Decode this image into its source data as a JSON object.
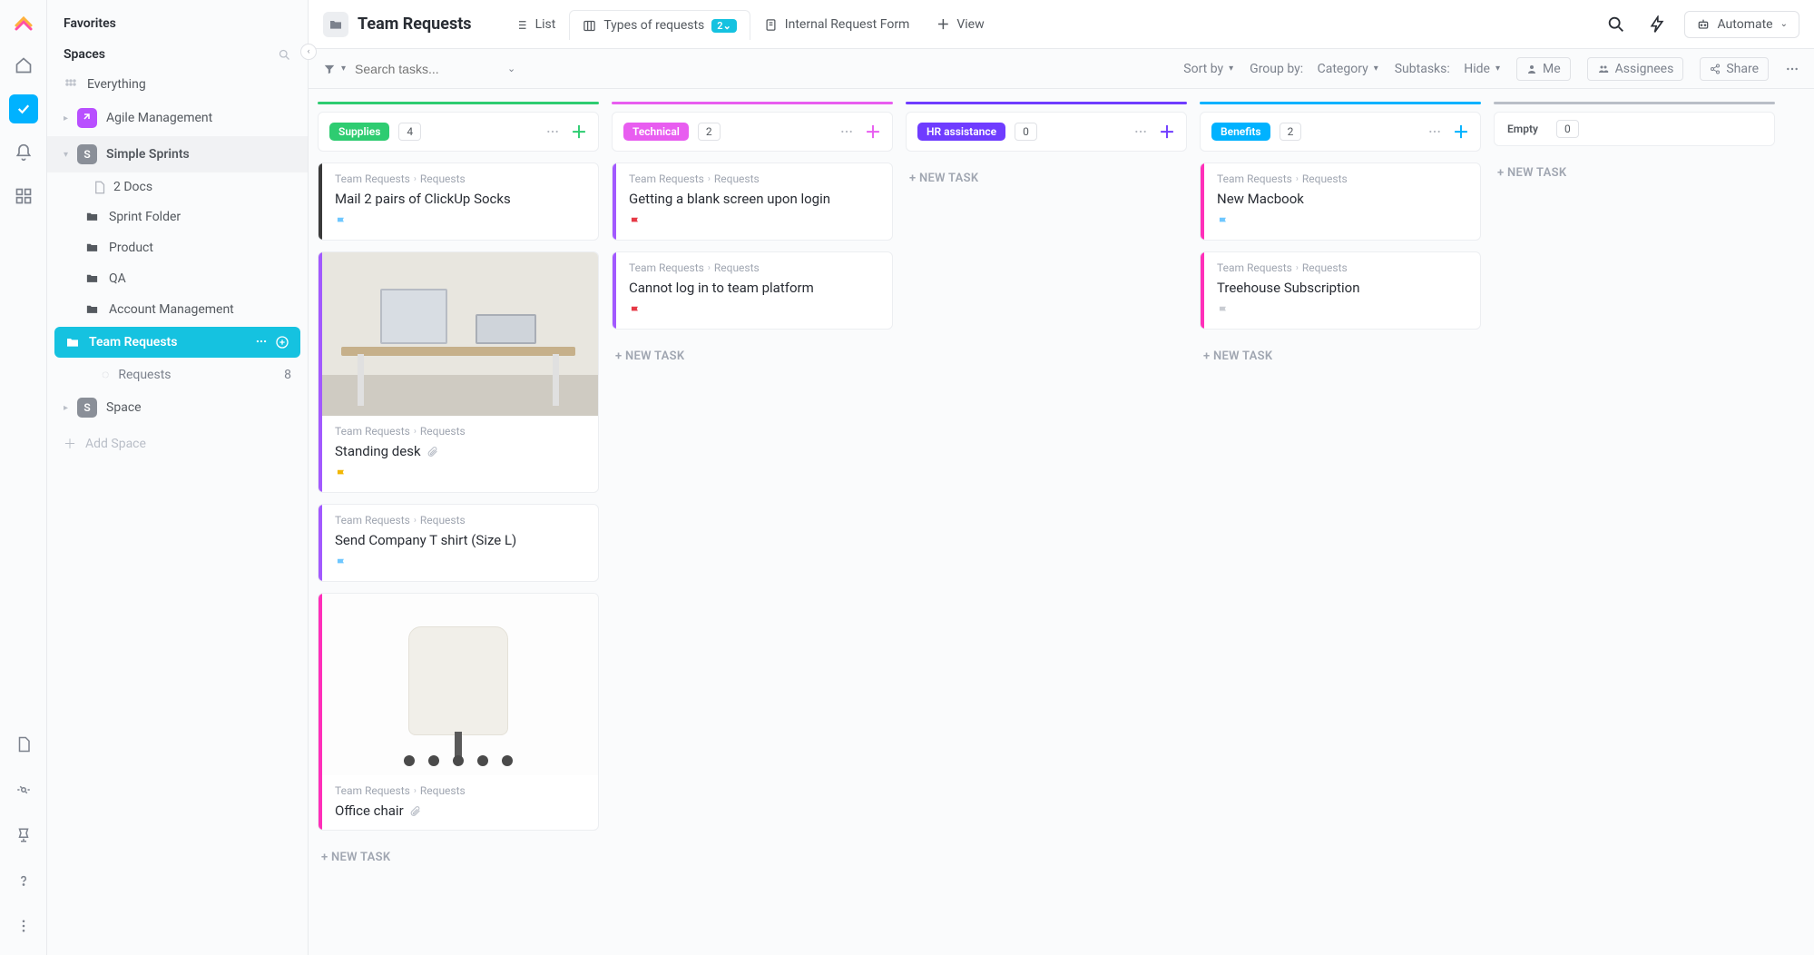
{
  "sidebar": {
    "favorites_label": "Favorites",
    "spaces_label": "Spaces",
    "everything_label": "Everything",
    "agile_label": "Agile Management",
    "simple_sprints_label": "Simple Sprints",
    "docs_link": "2 Docs",
    "folders": {
      "sprint": "Sprint Folder",
      "product": "Product",
      "qa": "QA",
      "account": "Account Management",
      "team_requests": "Team Requests"
    },
    "requests_list": "Requests",
    "requests_count": "8",
    "space_label": "Space",
    "add_space": "Add Space"
  },
  "header": {
    "title": "Team Requests",
    "tabs": {
      "list": "List",
      "types": "Types of requests",
      "types_badge": "2",
      "form": "Internal Request Form",
      "view": "View"
    },
    "automate": "Automate"
  },
  "toolbar": {
    "search_placeholder": "Search tasks...",
    "sort_by": "Sort by",
    "group_by_label": "Group by:",
    "group_by_value": "Category",
    "subtasks_label": "Subtasks:",
    "subtasks_value": "Hide",
    "me": "Me",
    "assignees": "Assignees",
    "share": "Share"
  },
  "board": {
    "new_task": "+ NEW TASK",
    "breadcrumb_parent": "Team Requests",
    "breadcrumb_child": "Requests",
    "columns": [
      {
        "id": "supplies",
        "label": "Supplies",
        "count": "4",
        "color": "#2ecc71",
        "bar": "#2ecc71",
        "plus": "#2ecc71",
        "cards": [
          {
            "stripe": "#3a3a3a",
            "title": "Mail 2 pairs of ClickUp Socks",
            "flag": "cyan",
            "image": false,
            "attach": false
          },
          {
            "stripe": "#a259ff",
            "title": "Standing desk",
            "flag": "yellow",
            "image": "desk",
            "attach": true
          },
          {
            "stripe": "#a259ff",
            "title": "Send Company T shirt (Size L)",
            "flag": "cyan",
            "image": false,
            "attach": false
          },
          {
            "stripe": "#ff2fb9",
            "title": "Office chair",
            "flag": "",
            "image": "chair",
            "attach": true
          }
        ]
      },
      {
        "id": "technical",
        "label": "Technical",
        "count": "2",
        "color": "#e85df0",
        "bar": "#e85df0",
        "plus": "#e85df0",
        "cards": [
          {
            "stripe": "#a259ff",
            "title": "Getting a blank screen upon login",
            "flag": "red",
            "image": false,
            "attach": false
          },
          {
            "stripe": "#a259ff",
            "title": "Cannot log in to team platform",
            "flag": "red",
            "image": false,
            "attach": false
          }
        ]
      },
      {
        "id": "hr",
        "label": "HR assistance",
        "count": "0",
        "color": "#6f3cff",
        "bar": "#6f3cff",
        "plus": "#6f3cff",
        "cards": []
      },
      {
        "id": "benefits",
        "label": "Benefits",
        "count": "2",
        "color": "#00b2ff",
        "bar": "#00b2ff",
        "plus": "#00b2ff",
        "cards": [
          {
            "stripe": "#ff2fb9",
            "title": "New Macbook",
            "flag": "cyan",
            "image": false,
            "attach": false
          },
          {
            "stripe": "#ff2fb9",
            "title": "Treehouse Subscription",
            "flag": "grey",
            "image": false,
            "attach": false
          }
        ]
      },
      {
        "id": "empty",
        "label": "Empty",
        "count": "0",
        "color": "#b9bec7",
        "bar": "#b9bec7",
        "plus": "#b9bec7",
        "labelOnly": true,
        "cards": []
      }
    ]
  }
}
